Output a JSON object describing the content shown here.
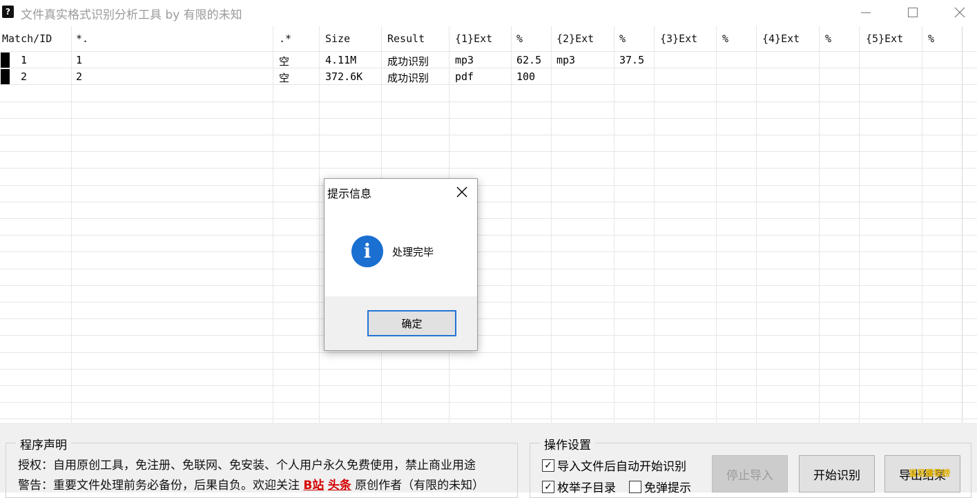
{
  "window": {
    "title": "文件真实格式识别分析工具 by 有限的未知",
    "app_icon_glyph": "?"
  },
  "table": {
    "columns": [
      "Match/ID",
      "*.",
      ".*",
      "Size",
      "Result",
      "{1}Ext",
      "%",
      "{2}Ext",
      "%",
      "{3}Ext",
      "%",
      "{4}Ext",
      "%",
      "{5}Ext",
      "%"
    ],
    "rows": [
      [
        "1",
        "1",
        "空",
        "4.11M",
        "成功识别",
        "mp3",
        "62.5",
        "mp3",
        "37.5",
        "",
        "",
        "",
        "",
        "",
        ""
      ],
      [
        "2",
        "2",
        "空",
        "372.6K",
        "成功识别",
        "pdf",
        "100",
        "",
        "",
        "",
        "",
        "",
        "",
        "",
        ""
      ]
    ]
  },
  "dialog": {
    "title": "提示信息",
    "message": "处理完毕",
    "ok_label": "确定",
    "icon_glyph": "i"
  },
  "notice": {
    "legend": "程序声明",
    "line1": "授权：自用原创工具，免注册、免联网、免安装、个人用户永久免费使用，禁止商业用途",
    "line2_before": "警告：重要文件处理前务必备份，后果自负。欢迎关注 ",
    "line2_b": "B站",
    "line2_toutiao": "头条",
    "line2_after": " 原创作者（有限的未知）"
  },
  "settings": {
    "legend": "操作设置",
    "auto_start_label": "导入文件后自动开始识别",
    "auto_start_checked": true,
    "enum_subdir_label": "枚举子目录",
    "enum_subdir_checked": true,
    "no_popup_label": "免弹提示",
    "no_popup_checked": false
  },
  "buttons": {
    "stop_import": "停止导入",
    "start": "开始识别",
    "export": "导出结果"
  },
  "watermark": "當易騰發鎊"
}
